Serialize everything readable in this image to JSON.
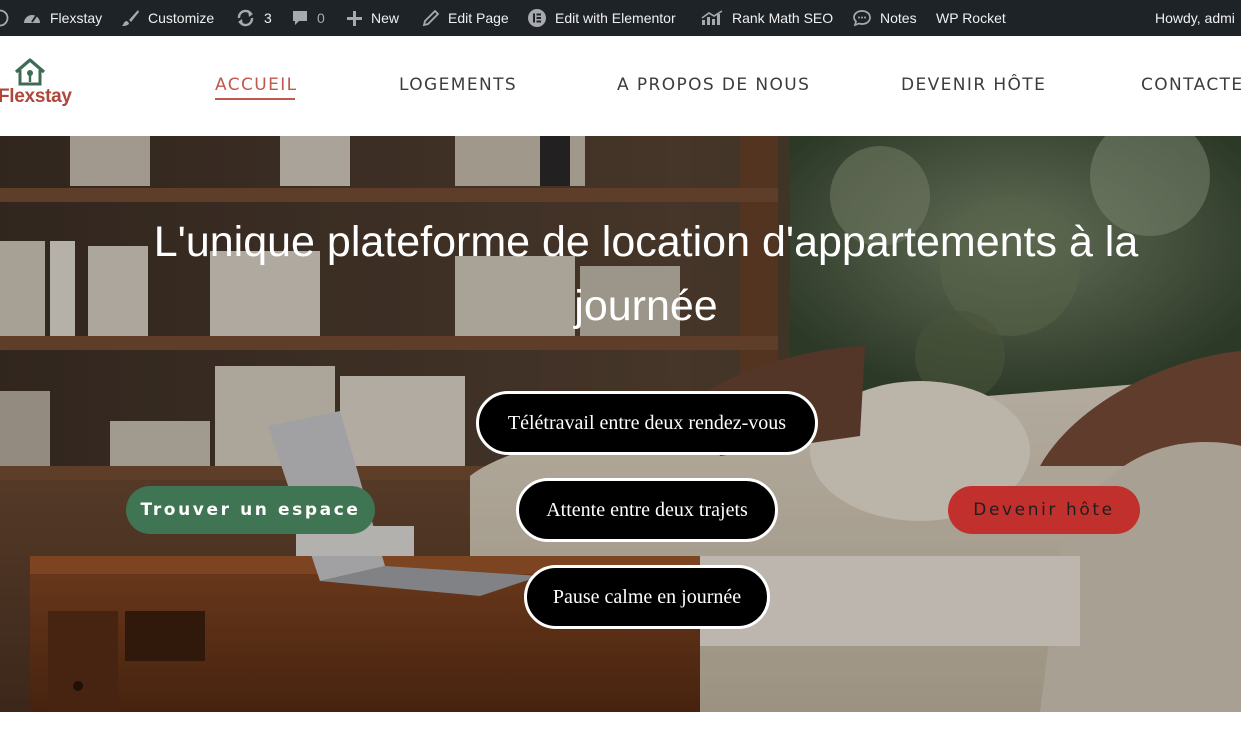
{
  "adminbar": {
    "site_name": "Flexstay",
    "customize": "Customize",
    "updates_count": "3",
    "comments_count": "0",
    "new": "New",
    "edit_page": "Edit Page",
    "edit_elementor": "Edit with Elementor",
    "rank_math": "Rank Math SEO",
    "notes": "Notes",
    "wp_rocket": "WP Rocket",
    "howdy": "Howdy, admi",
    "icons": [
      "wordpress-icon",
      "dashboard-icon",
      "brush-icon",
      "updates-icon",
      "comment-icon",
      "plus-icon",
      "pencil-icon",
      "elementor-icon",
      "rank-math-icon",
      "notes-icon"
    ]
  },
  "header": {
    "logo_text": "Flexstay",
    "nav": [
      {
        "label": "ACCUEIL",
        "active": true
      },
      {
        "label": "LOGEMENTS",
        "active": false
      },
      {
        "label": "A PROPOS DE NOUS",
        "active": false
      },
      {
        "label": "DEVENIR HÔTE",
        "active": false
      },
      {
        "label": "CONTACTEZ",
        "active": false
      }
    ]
  },
  "hero": {
    "title_line1": "L'unique plateforme de location d'appartements à la",
    "title_line2": "journée",
    "pills": [
      "Télétravail entre deux rendez-vous",
      "Attente entre deux trajets",
      "Pause calme en journée"
    ],
    "cta_primary": "Trouver un espace",
    "cta_secondary": "Devenir hôte"
  },
  "colors": {
    "adminbar_bg": "#1d2327",
    "logo_red": "#b0463b",
    "logo_green": "#3f6b55",
    "nav_active": "#c0584b",
    "btn_green": "#3f7553",
    "btn_red": "#c1302c"
  }
}
